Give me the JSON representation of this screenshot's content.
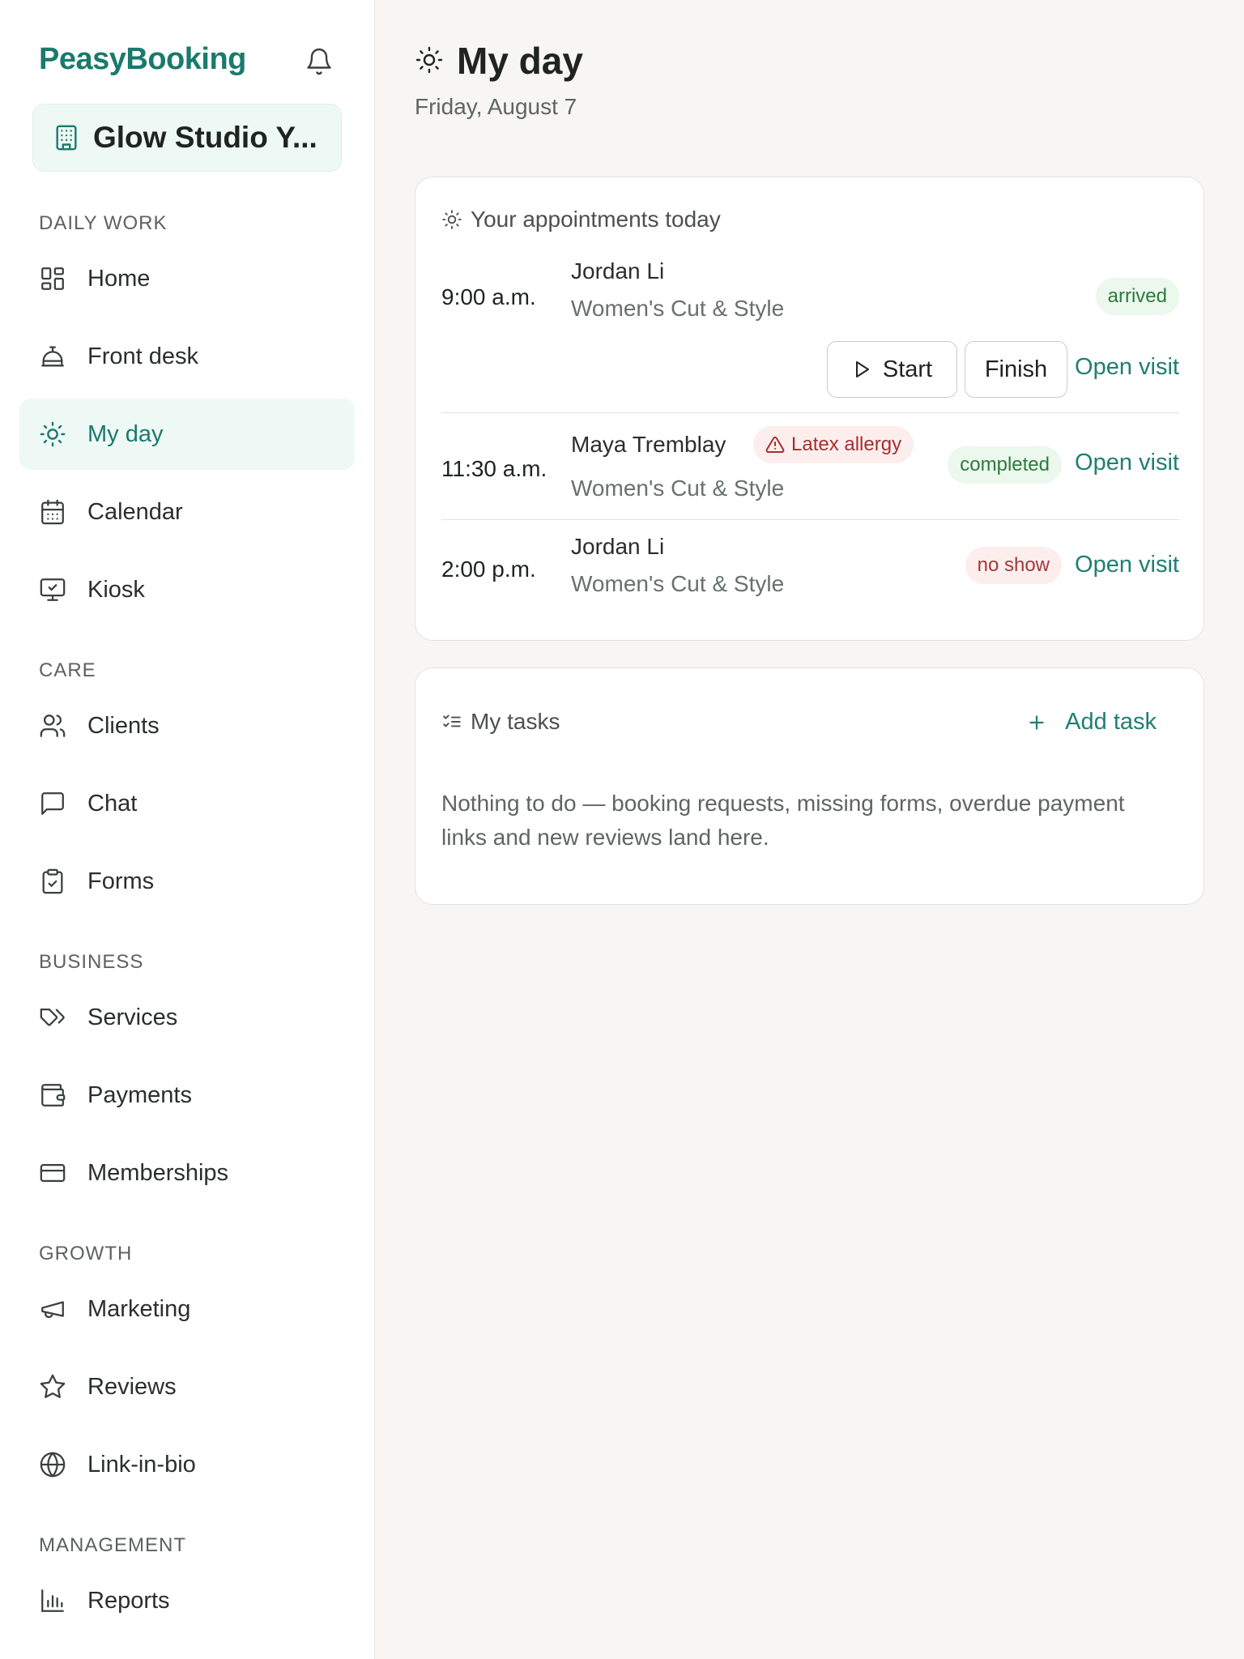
{
  "sidebar": {
    "brand": "PeasyBooking",
    "studio_name": "Glow Studio Y...",
    "sections": {
      "daily_work": "DAILY WORK",
      "care": "CARE",
      "business": "BUSINESS",
      "growth": "GROWTH",
      "management": "MANAGEMENT"
    },
    "items": {
      "home": "Home",
      "front_desk": "Front desk",
      "my_day": "My day",
      "calendar": "Calendar",
      "kiosk": "Kiosk",
      "clients": "Clients",
      "chat": "Chat",
      "forms": "Forms",
      "services": "Services",
      "payments": "Payments",
      "memberships": "Memberships",
      "marketing": "Marketing",
      "reviews": "Reviews",
      "link_in_bio": "Link-in-bio",
      "reports": "Reports"
    }
  },
  "header": {
    "title": "My day",
    "date": "Friday, August 7"
  },
  "appointments": {
    "heading": "Your appointments today",
    "open_label": "Open visit",
    "start_label": "Start",
    "finish_label": "Finish",
    "list": [
      {
        "time": "9:00 a.m.",
        "client": "Jordan Li",
        "service": "Women's Cut & Style",
        "status": "arrived"
      },
      {
        "time": "11:30 a.m.",
        "client": "Maya Tremblay",
        "alert": "Latex allergy",
        "service": "Women's Cut & Style",
        "status": "completed"
      },
      {
        "time": "2:00 p.m.",
        "client": "Jordan Li",
        "service": "Women's Cut & Style",
        "status": "no show"
      }
    ]
  },
  "tasks": {
    "heading": "My tasks",
    "add_label": "Add task",
    "empty_text": "Nothing to do — booking requests, missing forms, overdue payment links and new reviews land here."
  },
  "colors": {
    "accent": "#1a7a6c",
    "active_bg": "#eef8f5",
    "success": "#2b7a3c",
    "danger": "#a33a3a"
  }
}
